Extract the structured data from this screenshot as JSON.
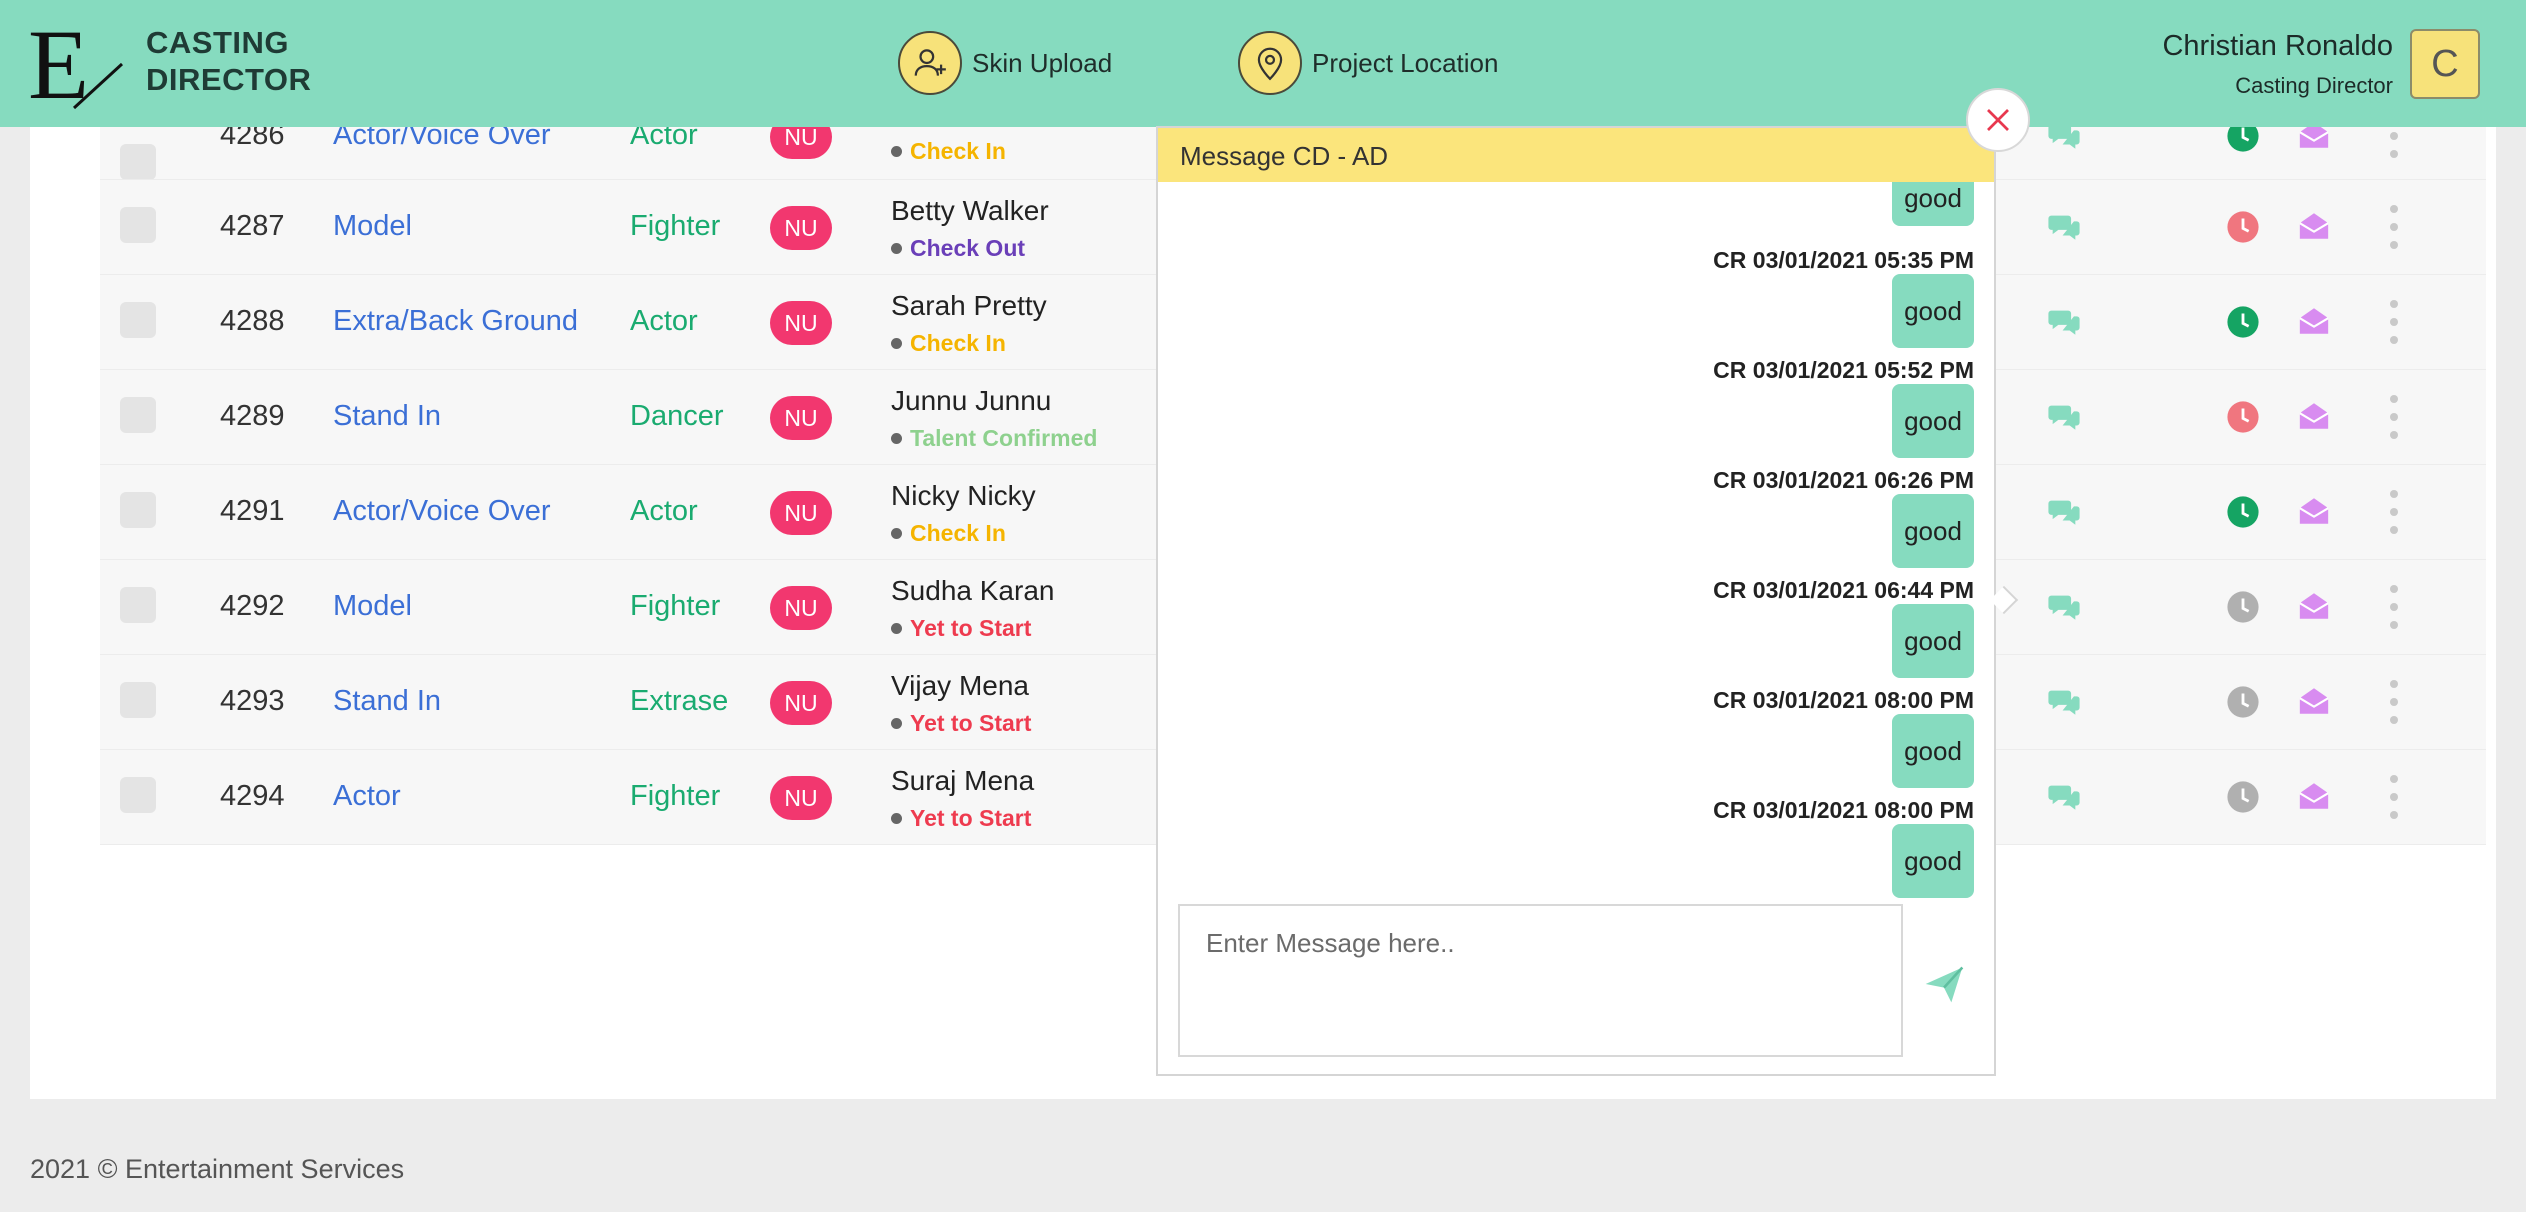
{
  "header": {
    "logo_letter": "E",
    "logo_line1": "CASTING",
    "logo_line2": "DIRECTOR",
    "nav": [
      {
        "label": "Skin Upload",
        "icon": "add-user-icon"
      },
      {
        "label": "Project Location",
        "icon": "location-pin-icon"
      }
    ],
    "user_name": "Christian Ronaldo",
    "user_role": "Casting Director",
    "avatar_letter": "C"
  },
  "colors": {
    "header_bg": "#86dbbf",
    "accent_yellow": "#fbe57c",
    "badge_pink": "#f2376f",
    "role_blue": "#3b6fd6",
    "category_green": "#1aab70",
    "status_check_in": "#f5b400",
    "status_check_out": "#6a3fb8",
    "status_confirmed": "#8ed18e",
    "status_yet": "#ee3b4f",
    "clock_red": "#f0767f",
    "clock_green": "#15a463",
    "clock_grey": "#b0b0b0",
    "mail_purple": "#d88cf0",
    "chat_teal": "#86dbbf"
  },
  "table": {
    "rows": [
      {
        "id": "4286",
        "role": "Actor/Voice Over",
        "category": "Actor",
        "badge": "NU",
        "name": "",
        "status": "Check In",
        "status_color": "#f5b400",
        "clock": "#15a463",
        "clock_state": "green"
      },
      {
        "id": "4287",
        "role": "Model",
        "category": "Fighter",
        "badge": "NU",
        "name": "Betty Walker",
        "status": "Check Out",
        "status_color": "#6a3fb8",
        "clock": "#f0767f",
        "clock_state": "red"
      },
      {
        "id": "4288",
        "role": "Extra/Back Ground",
        "category": "Actor",
        "badge": "NU",
        "name": "Sarah Pretty",
        "status": "Check In",
        "status_color": "#f5b400",
        "clock": "#15a463",
        "clock_state": "green"
      },
      {
        "id": "4289",
        "role": "Stand In",
        "category": "Dancer",
        "badge": "NU",
        "name": "Junnu Junnu",
        "status": "Talent Confirmed",
        "status_color": "#8ed18e",
        "clock": "#f0767f",
        "clock_state": "red"
      },
      {
        "id": "4291",
        "role": "Actor/Voice Over",
        "category": "Actor",
        "badge": "NU",
        "name": "Nicky Nicky",
        "status": "Check In",
        "status_color": "#f5b400",
        "clock": "#15a463",
        "clock_state": "green"
      },
      {
        "id": "4292",
        "role": "Model",
        "category": "Fighter",
        "badge": "NU",
        "name": "Sudha Karan",
        "status": "Yet to Start",
        "status_color": "#ee3b4f",
        "clock": "#b0b0b0",
        "clock_state": "grey"
      },
      {
        "id": "4293",
        "role": "Stand In",
        "category": "Extrase",
        "badge": "NU",
        "name": "Vijay Mena",
        "status": "Yet to Start",
        "status_color": "#ee3b4f",
        "clock": "#b0b0b0",
        "clock_state": "grey"
      },
      {
        "id": "4294",
        "role": "Actor",
        "category": "Fighter",
        "badge": "NU",
        "name": "Suraj Mena",
        "status": "Yet to Start",
        "status_color": "#ee3b4f",
        "clock": "#b0b0b0",
        "clock_state": "grey"
      }
    ]
  },
  "chat": {
    "title": "Message CD - AD",
    "messages": [
      {
        "meta": "",
        "text": "good"
      },
      {
        "meta": "CR 03/01/2021 05:35 PM",
        "text": "good"
      },
      {
        "meta": "CR 03/01/2021 05:52 PM",
        "text": "good"
      },
      {
        "meta": "CR 03/01/2021 06:26 PM",
        "text": "good"
      },
      {
        "meta": "CR 03/01/2021 06:44 PM",
        "text": "good"
      },
      {
        "meta": "CR 03/01/2021 08:00 PM",
        "text": "good"
      },
      {
        "meta": "CR 03/01/2021 08:00 PM",
        "text": "good"
      }
    ],
    "input_placeholder": "Enter Message here..",
    "input_value": ""
  },
  "footer": {
    "text": "2021 © Entertainment Services"
  }
}
